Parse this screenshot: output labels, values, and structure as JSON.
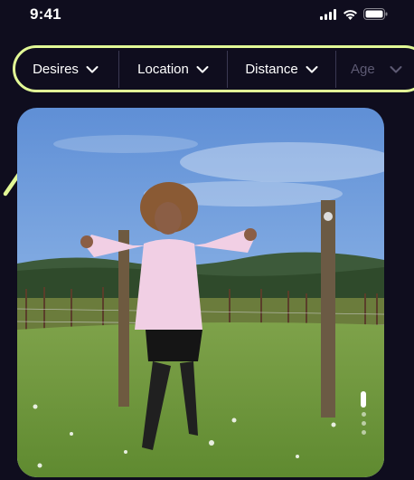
{
  "status_bar": {
    "time": "9:41",
    "icons": [
      "signal-icon",
      "wifi-icon",
      "battery-icon"
    ]
  },
  "filters": [
    {
      "label": "Desires",
      "icon": "chevron-down-icon"
    },
    {
      "label": "Location",
      "icon": "chevron-down-icon"
    },
    {
      "label": "Distance",
      "icon": "chevron-down-icon"
    },
    {
      "label": "Age",
      "icon": "chevron-down-icon"
    }
  ],
  "photo": {
    "image_count": 4,
    "active_index": 0
  },
  "colors": {
    "background": "#0f0d1e",
    "highlight": "#e2f896",
    "divider": "#3a3852",
    "faded_text": "#5d5a73"
  }
}
